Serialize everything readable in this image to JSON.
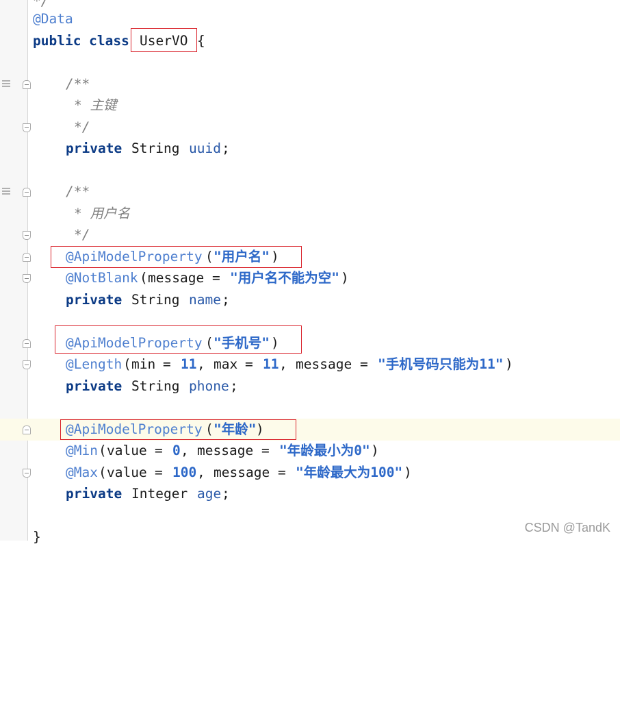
{
  "lines": {
    "comment_tail": "*/",
    "data_ann": "@Data",
    "class_kw": "public class",
    "class_name": "UserVO",
    "open_brace": "{",
    "doc_open": "/**",
    "doc_uuid": "* 主键",
    "doc_close": "*/",
    "private_kw": "private",
    "type_string": "String",
    "type_integer": "Integer",
    "field_uuid": "uuid",
    "doc_username": "* 用户名",
    "ann_api": "@ApiModelProperty",
    "str_username": "\"用户名\"",
    "ann_notblank": "@NotBlank",
    "msg_key": "message",
    "str_username_msg": "\"用户名不能为空\"",
    "field_name": "name",
    "str_phone": "\"手机号\"",
    "ann_length": "@Length",
    "min_key": "min",
    "max_key": "max",
    "value_key": "value",
    "num_11": "11",
    "str_phone_msg": "\"手机号码只能为11\"",
    "field_phone": "phone",
    "str_age": "\"年龄\"",
    "ann_min": "@Min",
    "num_0": "0",
    "str_age_min": "\"年龄最小为0\"",
    "ann_max": "@Max",
    "num_100": "100",
    "str_age_max": "\"年龄最大为100\"",
    "field_age": "age",
    "close_brace": "}"
  },
  "watermark": "CSDN @TandK"
}
